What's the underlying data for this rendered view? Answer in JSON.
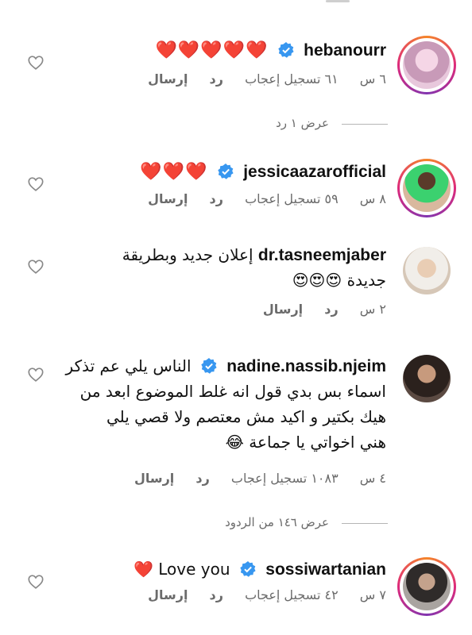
{
  "comments": [
    {
      "username": "hebanourr",
      "text": "❤️❤️❤️❤️❤️",
      "time": "٦ س",
      "likes": "٦١ تسجيل إعجاب",
      "reply": "رد",
      "send": "إرسال",
      "view_replies": "عرض ١ رد"
    },
    {
      "username": "jessicaazarofficial",
      "text": "❤️❤️❤️",
      "time": "٨ س",
      "likes": "٥٩ تسجيل إعجاب",
      "reply": "رد",
      "send": "إرسال"
    },
    {
      "username": "dr.tasneemjaber",
      "text_line1": "إعلان جديد وبطريقة",
      "text_line2": "جديدة 😍😍😍",
      "time": "٢ س",
      "reply": "رد",
      "send": "إرسال"
    },
    {
      "username": "nadine.nassib.njeim",
      "text_line1": "الناس يلي عم تذكر",
      "text_line2": "اسماء بس بدي قول انه غلط الموضوع ابعد من",
      "text_line3": "هيك بكتير و اكيد مش معتصم ولا قصي يلي",
      "text_line4": "هني اخواتي يا جماعة 😂",
      "time": "٤ س",
      "likes": "١٠٨٣ تسجيل إعجاب",
      "reply": "رد",
      "send": "إرسال",
      "view_replies": "عرض ١٤٦ من الردود"
    },
    {
      "username": "sossiwartanian",
      "text": "Love you ❤️",
      "time": "٧ س",
      "likes": "٤٢ تسجيل إعجاب",
      "reply": "رد",
      "send": "إرسال"
    }
  ],
  "colors": {
    "heart": "#e0192f",
    "verified": "#3897f0",
    "meta": "#6b6b6b"
  },
  "icons": {
    "like": "heart-outline-icon",
    "verified": "verified-badge-icon"
  }
}
